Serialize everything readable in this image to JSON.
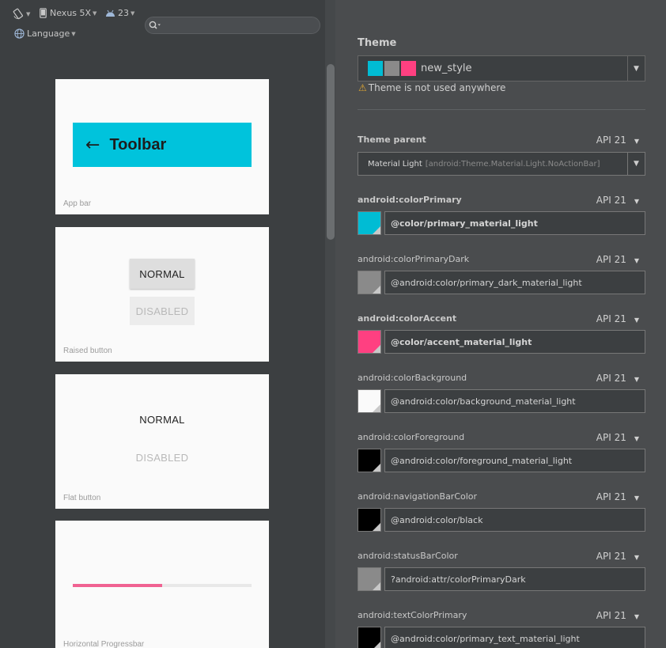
{
  "toolbar": {
    "orientation_icon": "rotate-device-icon",
    "device_label": "Nexus 5X",
    "api_label": "23",
    "language_label": "Language",
    "search_placeholder": ""
  },
  "preview": {
    "cards": [
      {
        "label": "App bar",
        "toolbar_title": "Toolbar"
      },
      {
        "label": "Raised button",
        "normal": "NORMAL",
        "disabled": "DISABLED"
      },
      {
        "label": "Flat button",
        "normal": "NORMAL",
        "disabled": "DISABLED"
      },
      {
        "label": "Horizontal Progressbar",
        "progress_fraction": 0.5
      }
    ]
  },
  "theme": {
    "header": "Theme",
    "name": "new_style",
    "swatches": [
      "#00bcd4",
      "#8a8a8a",
      "#ff4081"
    ],
    "warning": "Theme is not used anywhere",
    "parent": {
      "label": "Theme parent",
      "api": "API 21",
      "name": "Material Light",
      "qualified": "[android:Theme.Material.Light.NoActionBar]"
    },
    "attributes": [
      {
        "name": "android:colorPrimary",
        "api": "API 21",
        "value": "@color/primary_material_light",
        "color": "#00bcd4",
        "bold": true
      },
      {
        "name": "android:colorPrimaryDark",
        "api": "API 21",
        "value": "@android:color/primary_dark_material_light",
        "color": "#8a8a8a",
        "bold": false
      },
      {
        "name": "android:colorAccent",
        "api": "API 21",
        "value": "@color/accent_material_light",
        "color": "#ff4081",
        "bold": true
      },
      {
        "name": "android:colorBackground",
        "api": "API 21",
        "value": "@android:color/background_material_light",
        "color": "#fafafa",
        "bold": false
      },
      {
        "name": "android:colorForeground",
        "api": "API 21",
        "value": "@android:color/foreground_material_light",
        "color": "#000000",
        "bold": false
      },
      {
        "name": "android:navigationBarColor",
        "api": "API 21",
        "value": "@android:color/black",
        "color": "#000000",
        "bold": false
      },
      {
        "name": "android:statusBarColor",
        "api": "API 21",
        "value": "?android:attr/colorPrimaryDark",
        "color": "#8a8a8a",
        "bold": false
      },
      {
        "name": "android:textColorPrimary",
        "api": "API 21",
        "value": "@android:color/primary_text_material_light",
        "color": "#000000",
        "bold": false
      }
    ]
  }
}
